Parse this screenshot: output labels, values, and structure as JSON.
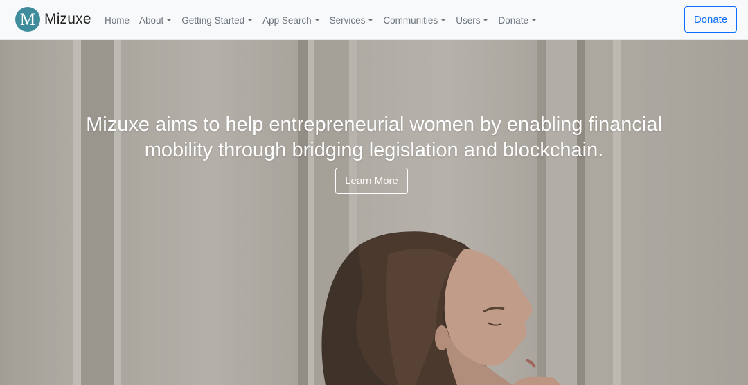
{
  "brand": {
    "logo_letter": "M",
    "name": "Mizuxe",
    "logo_color": "#3f8c9d"
  },
  "nav": {
    "items": [
      {
        "label": "Home",
        "dropdown": false
      },
      {
        "label": "About",
        "dropdown": true
      },
      {
        "label": "Getting Started",
        "dropdown": true
      },
      {
        "label": "App Search",
        "dropdown": true
      },
      {
        "label": "Services",
        "dropdown": true
      },
      {
        "label": "Communities",
        "dropdown": true
      },
      {
        "label": "Users",
        "dropdown": true
      },
      {
        "label": "Donate",
        "dropdown": true
      }
    ],
    "donate_button": "Donate",
    "donate_color": "#0d6efd"
  },
  "hero": {
    "headline_line1": "Mizuxe aims to help entrepreneurial women by enabling financial",
    "headline_line2": "mobility through bridging legislation and blockchain.",
    "cta_label": "Learn More",
    "image_subject": "woman with closed eyes in front of concrete wall"
  }
}
